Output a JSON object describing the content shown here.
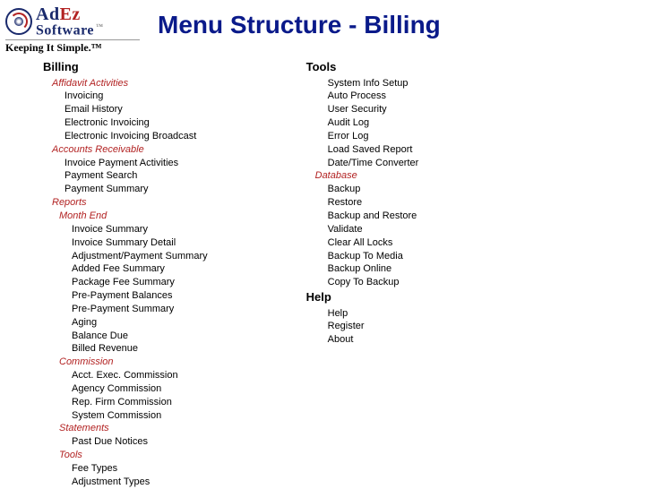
{
  "logo": {
    "line1a": "Ad",
    "line1b": "Ez",
    "line2": "Software",
    "tm": "™",
    "tagline": "Keeping It Simple.™"
  },
  "title": "Menu Structure - Billing",
  "left": {
    "heading": "Billing",
    "g1": "Affidavit Activities",
    "g1_items": [
      "Invoicing",
      "Email History",
      "Electronic Invoicing",
      "Electronic Invoicing Broadcast"
    ],
    "g2": "Accounts Receivable",
    "g2_items": [
      "Invoice Payment Activities",
      "Payment Search",
      "Payment Summary"
    ],
    "g3": "Reports",
    "g3a": "Month End",
    "g3a_items": [
      "Invoice Summary",
      "Invoice Summary Detail",
      "Adjustment/Payment Summary",
      "Added Fee Summary",
      "Package Fee Summary",
      "Pre-Payment Balances",
      "Pre-Payment Summary",
      "Aging",
      "Balance Due",
      "Billed Revenue"
    ],
    "g3b": "Commission",
    "g3b_items": [
      "Acct. Exec. Commission",
      "Agency Commission",
      "Rep. Firm Commission",
      "System Commission"
    ],
    "g3c": "Statements",
    "g3c_items": [
      "Past Due Notices"
    ],
    "g3d": "Tools",
    "g3d_items": [
      "Fee Types",
      "Adjustment Types"
    ]
  },
  "right": {
    "h1": "Tools",
    "h1_items": [
      "System Info Setup",
      "Auto Process",
      "User Security",
      "Audit Log",
      "Error Log",
      "Load Saved Report",
      "Date/Time Converter"
    ],
    "h1_db": "Database",
    "h1_db_items": [
      "Backup",
      "Restore",
      "Backup and Restore",
      "Validate",
      "Clear All Locks",
      "Backup To Media",
      "Backup Online",
      "Copy To Backup"
    ],
    "h2": "Help",
    "h2_items": [
      "Help",
      "Register",
      "About"
    ]
  }
}
